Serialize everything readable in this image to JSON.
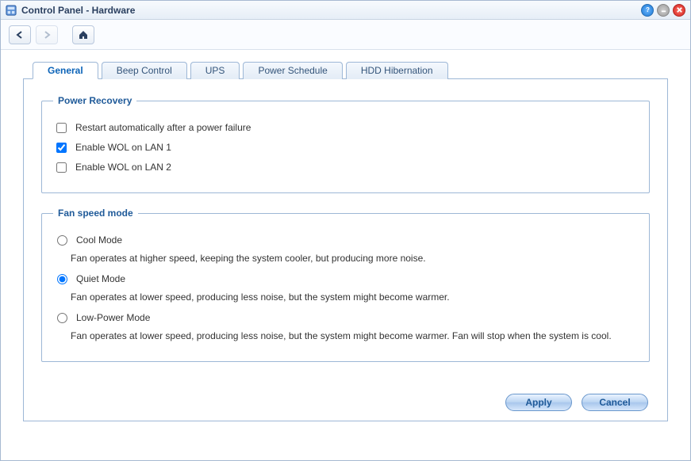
{
  "window": {
    "title": "Control Panel - Hardware"
  },
  "tabs": [
    {
      "label": "General",
      "active": true
    },
    {
      "label": "Beep Control",
      "active": false
    },
    {
      "label": "UPS",
      "active": false
    },
    {
      "label": "Power Schedule",
      "active": false
    },
    {
      "label": "HDD Hibernation",
      "active": false
    }
  ],
  "power_recovery": {
    "legend": "Power Recovery",
    "options": [
      {
        "label": "Restart automatically after a power failure",
        "checked": false
      },
      {
        "label": "Enable WOL on LAN 1",
        "checked": true
      },
      {
        "label": "Enable WOL on LAN 2",
        "checked": false
      }
    ]
  },
  "fan_speed": {
    "legend": "Fan speed mode",
    "modes": [
      {
        "label": "Cool Mode",
        "desc": "Fan operates at higher speed, keeping the system cooler, but producing more noise.",
        "selected": false
      },
      {
        "label": "Quiet Mode",
        "desc": "Fan operates at lower speed, producing less noise, but the system might become warmer.",
        "selected": true
      },
      {
        "label": "Low-Power Mode",
        "desc": "Fan operates at lower speed, producing less noise, but the system might become warmer. Fan will stop when the system is cool.",
        "selected": false
      }
    ]
  },
  "buttons": {
    "apply": "Apply",
    "cancel": "Cancel"
  }
}
